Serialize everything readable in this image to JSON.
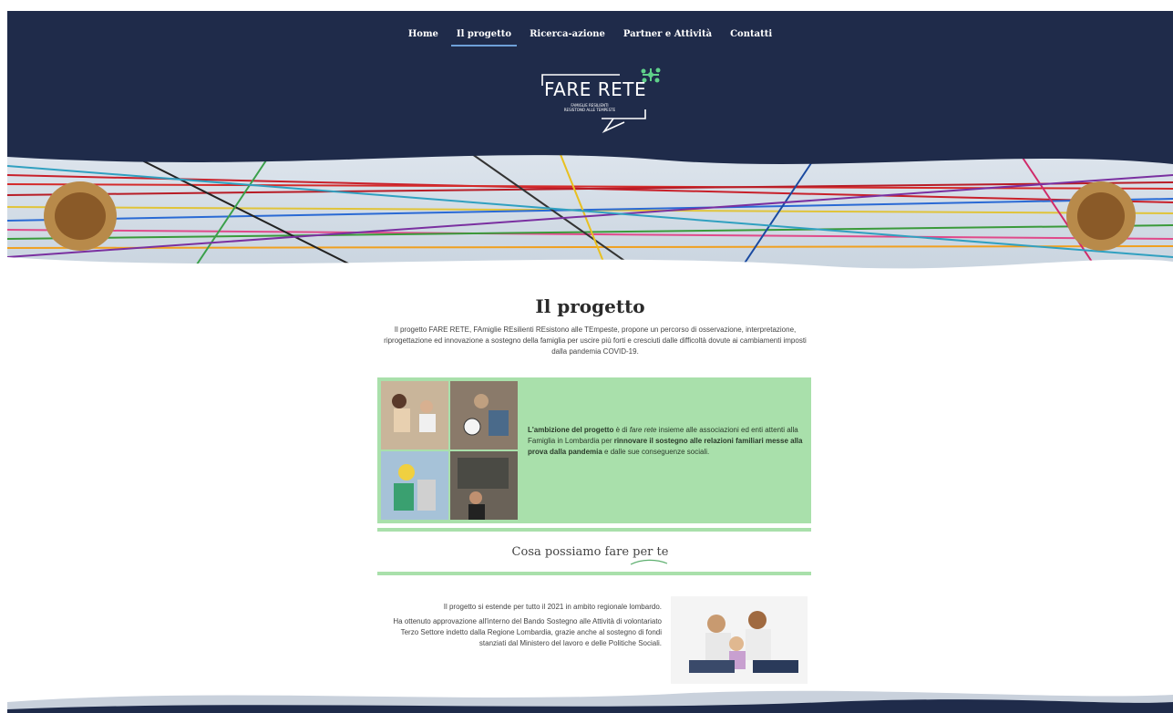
{
  "nav": {
    "items": [
      {
        "label": "Home",
        "active": false
      },
      {
        "label": "Il progetto",
        "active": true
      },
      {
        "label": "Ricerca-azione",
        "active": false
      },
      {
        "label": "Partner e Attività",
        "active": false
      },
      {
        "label": "Contatti",
        "active": false
      }
    ]
  },
  "logo": {
    "title": "FARE RETE",
    "subtitle_1": "FAMIGLIE RESILIENTI",
    "subtitle_2": "RESISTONO ALLE TEMPESTE"
  },
  "main": {
    "title": "Il progetto",
    "intro": "Il progetto FARE RETE, FAmiglie REsilienti REsistono alle TEmpeste, propone un percorso di osservazione, interpretazione, riprogettazione ed innovazione a sostegno della famiglia per uscire più forti e cresciuti dalle difficoltà dovute ai cambiamenti imposti dalla pandemia COVID-19.",
    "ambition": {
      "part1": "L'ambizione del progetto",
      "part2": " è di ",
      "part3": "fare rete",
      "part4": " insieme alle associazioni ed enti attenti alla Famiglia in Lombardia per ",
      "part5": "rinnovare il sostegno alle relazioni familiari messe alla prova dalla pandemia",
      "part6": " e dalle sue conseguenze sociali."
    },
    "section_title": "Cosa possiamo fare per te",
    "bottom_p1": "Il progetto si estende per tutto il 2021 in ambito regionale lombardo.",
    "bottom_p2": "Ha ottenuto approvazione all'interno del Bando Sostegno alle Attività di volontariato Terzo Settore indetto dalla Regione Lombardia, grazie anche al sostegno di fondi stanziati dal Ministero del lavoro e delle Politiche Sociali."
  },
  "colors": {
    "header_bg": "#1f2b4a",
    "accent_green": "#a9e0ab",
    "logo_accent": "#5fd08a"
  }
}
